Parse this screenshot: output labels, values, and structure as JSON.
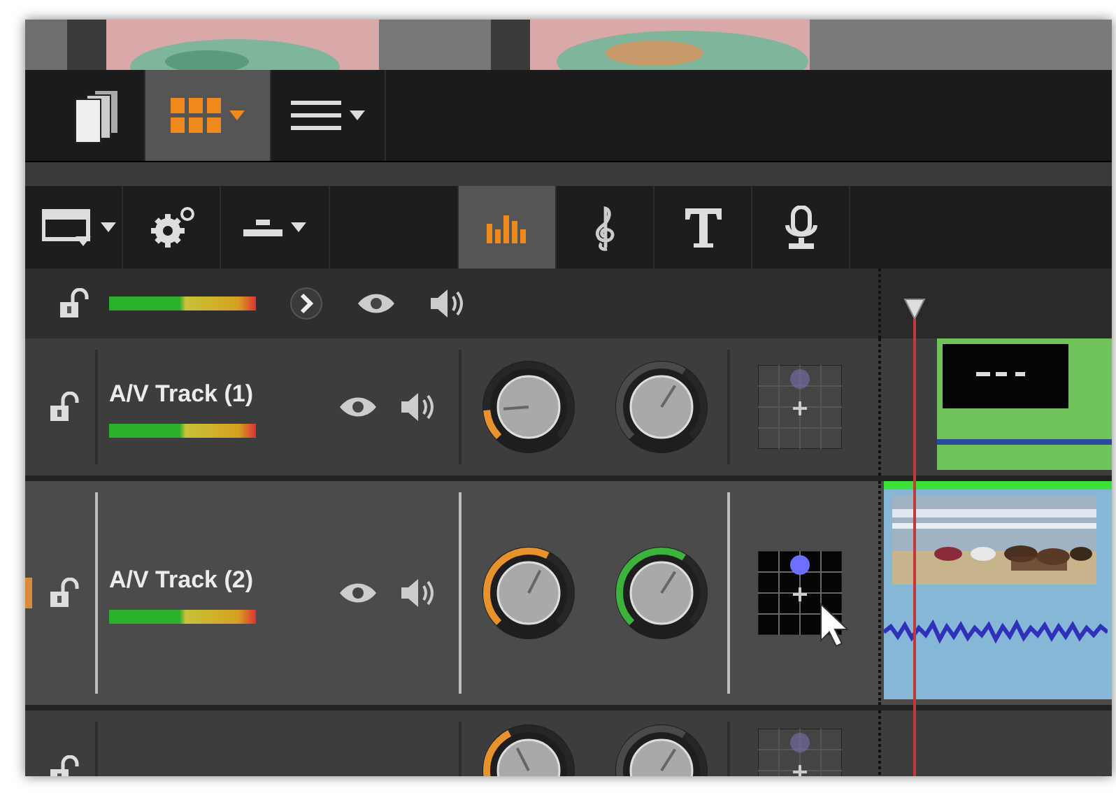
{
  "library_toolbar": {
    "buttons": [
      {
        "kind": "stack",
        "selected": false,
        "dropdown": false
      },
      {
        "kind": "grid",
        "selected": true,
        "dropdown": true
      },
      {
        "kind": "list",
        "selected": false,
        "dropdown": true
      }
    ]
  },
  "timeline_toolbar": {
    "tools": [
      {
        "kind": "track-layout",
        "dropdown": true
      },
      {
        "kind": "settings",
        "dropdown": false
      },
      {
        "kind": "insert",
        "dropdown": true
      }
    ],
    "tabs": [
      {
        "kind": "mixer",
        "selected": true
      },
      {
        "kind": "music",
        "selected": false
      },
      {
        "kind": "title",
        "selected": false
      },
      {
        "kind": "voice",
        "selected": false
      }
    ]
  },
  "master": {
    "level": 1
  },
  "tracks": [
    {
      "name": "A/V Track (1)",
      "selected": false,
      "level": 1,
      "volume": {
        "level": 0.15
      },
      "balance": {
        "level": 0.62,
        "active": false
      },
      "pan_active": false,
      "clip": {
        "kind": "title"
      }
    },
    {
      "name": "A/V Track (2)",
      "selected": true,
      "level": 1,
      "volume": {
        "level": 0.6
      },
      "balance": {
        "level": 0.62,
        "active": true
      },
      "pan_active": true,
      "clip": {
        "kind": "video"
      }
    },
    {
      "selected": false,
      "volume": {
        "level": 0.4
      },
      "balance": {
        "level": 0.62,
        "active": false
      },
      "pan_active": false
    }
  ]
}
